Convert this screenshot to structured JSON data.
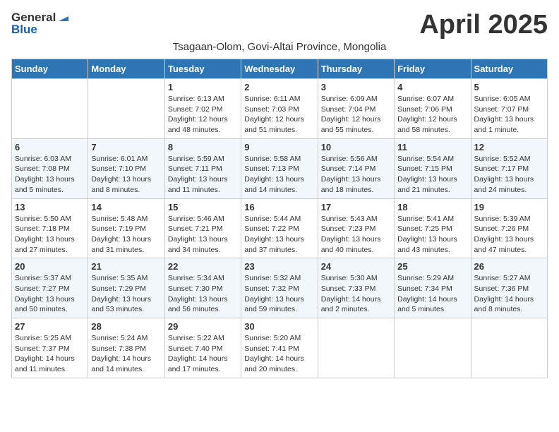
{
  "header": {
    "logo_general": "General",
    "logo_blue": "Blue",
    "month_title": "April 2025",
    "subtitle": "Tsagaan-Olom, Govi-Altai Province, Mongolia"
  },
  "weekdays": [
    "Sunday",
    "Monday",
    "Tuesday",
    "Wednesday",
    "Thursday",
    "Friday",
    "Saturday"
  ],
  "weeks": [
    [
      {
        "day": "",
        "info": ""
      },
      {
        "day": "",
        "info": ""
      },
      {
        "day": "1",
        "info": "Sunrise: 6:13 AM\nSunset: 7:02 PM\nDaylight: 12 hours and 48 minutes."
      },
      {
        "day": "2",
        "info": "Sunrise: 6:11 AM\nSunset: 7:03 PM\nDaylight: 12 hours and 51 minutes."
      },
      {
        "day": "3",
        "info": "Sunrise: 6:09 AM\nSunset: 7:04 PM\nDaylight: 12 hours and 55 minutes."
      },
      {
        "day": "4",
        "info": "Sunrise: 6:07 AM\nSunset: 7:06 PM\nDaylight: 12 hours and 58 minutes."
      },
      {
        "day": "5",
        "info": "Sunrise: 6:05 AM\nSunset: 7:07 PM\nDaylight: 13 hours and 1 minute."
      }
    ],
    [
      {
        "day": "6",
        "info": "Sunrise: 6:03 AM\nSunset: 7:08 PM\nDaylight: 13 hours and 5 minutes."
      },
      {
        "day": "7",
        "info": "Sunrise: 6:01 AM\nSunset: 7:10 PM\nDaylight: 13 hours and 8 minutes."
      },
      {
        "day": "8",
        "info": "Sunrise: 5:59 AM\nSunset: 7:11 PM\nDaylight: 13 hours and 11 minutes."
      },
      {
        "day": "9",
        "info": "Sunrise: 5:58 AM\nSunset: 7:13 PM\nDaylight: 13 hours and 14 minutes."
      },
      {
        "day": "10",
        "info": "Sunrise: 5:56 AM\nSunset: 7:14 PM\nDaylight: 13 hours and 18 minutes."
      },
      {
        "day": "11",
        "info": "Sunrise: 5:54 AM\nSunset: 7:15 PM\nDaylight: 13 hours and 21 minutes."
      },
      {
        "day": "12",
        "info": "Sunrise: 5:52 AM\nSunset: 7:17 PM\nDaylight: 13 hours and 24 minutes."
      }
    ],
    [
      {
        "day": "13",
        "info": "Sunrise: 5:50 AM\nSunset: 7:18 PM\nDaylight: 13 hours and 27 minutes."
      },
      {
        "day": "14",
        "info": "Sunrise: 5:48 AM\nSunset: 7:19 PM\nDaylight: 13 hours and 31 minutes."
      },
      {
        "day": "15",
        "info": "Sunrise: 5:46 AM\nSunset: 7:21 PM\nDaylight: 13 hours and 34 minutes."
      },
      {
        "day": "16",
        "info": "Sunrise: 5:44 AM\nSunset: 7:22 PM\nDaylight: 13 hours and 37 minutes."
      },
      {
        "day": "17",
        "info": "Sunrise: 5:43 AM\nSunset: 7:23 PM\nDaylight: 13 hours and 40 minutes."
      },
      {
        "day": "18",
        "info": "Sunrise: 5:41 AM\nSunset: 7:25 PM\nDaylight: 13 hours and 43 minutes."
      },
      {
        "day": "19",
        "info": "Sunrise: 5:39 AM\nSunset: 7:26 PM\nDaylight: 13 hours and 47 minutes."
      }
    ],
    [
      {
        "day": "20",
        "info": "Sunrise: 5:37 AM\nSunset: 7:27 PM\nDaylight: 13 hours and 50 minutes."
      },
      {
        "day": "21",
        "info": "Sunrise: 5:35 AM\nSunset: 7:29 PM\nDaylight: 13 hours and 53 minutes."
      },
      {
        "day": "22",
        "info": "Sunrise: 5:34 AM\nSunset: 7:30 PM\nDaylight: 13 hours and 56 minutes."
      },
      {
        "day": "23",
        "info": "Sunrise: 5:32 AM\nSunset: 7:32 PM\nDaylight: 13 hours and 59 minutes."
      },
      {
        "day": "24",
        "info": "Sunrise: 5:30 AM\nSunset: 7:33 PM\nDaylight: 14 hours and 2 minutes."
      },
      {
        "day": "25",
        "info": "Sunrise: 5:29 AM\nSunset: 7:34 PM\nDaylight: 14 hours and 5 minutes."
      },
      {
        "day": "26",
        "info": "Sunrise: 5:27 AM\nSunset: 7:36 PM\nDaylight: 14 hours and 8 minutes."
      }
    ],
    [
      {
        "day": "27",
        "info": "Sunrise: 5:25 AM\nSunset: 7:37 PM\nDaylight: 14 hours and 11 minutes."
      },
      {
        "day": "28",
        "info": "Sunrise: 5:24 AM\nSunset: 7:38 PM\nDaylight: 14 hours and 14 minutes."
      },
      {
        "day": "29",
        "info": "Sunrise: 5:22 AM\nSunset: 7:40 PM\nDaylight: 14 hours and 17 minutes."
      },
      {
        "day": "30",
        "info": "Sunrise: 5:20 AM\nSunset: 7:41 PM\nDaylight: 14 hours and 20 minutes."
      },
      {
        "day": "",
        "info": ""
      },
      {
        "day": "",
        "info": ""
      },
      {
        "day": "",
        "info": ""
      }
    ]
  ]
}
